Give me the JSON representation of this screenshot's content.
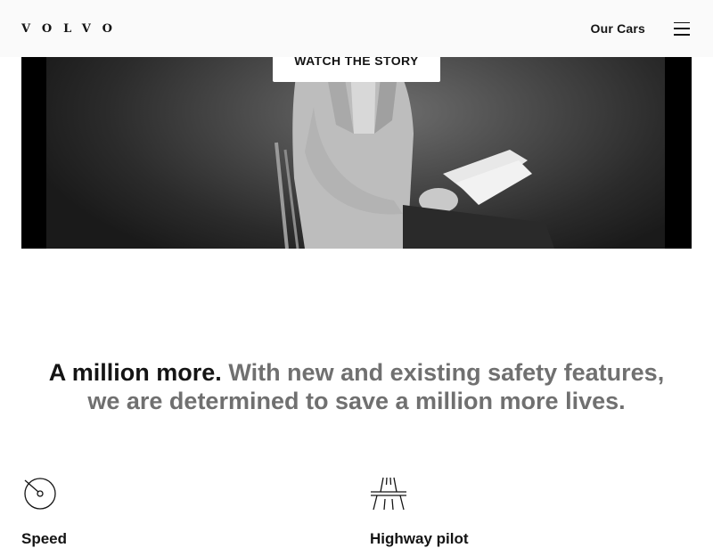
{
  "header": {
    "logo": "VOLVO",
    "nav_link": "Our Cars",
    "menu_icon": "hamburger-menu-icon"
  },
  "hero": {
    "button_label": "WATCH THE STORY"
  },
  "statement": {
    "lead": "A million more.",
    "body": "With new and existing safety features, we are determined to save a million more lives."
  },
  "features": [
    {
      "icon": "speedometer-icon",
      "title": "Speed"
    },
    {
      "icon": "highway-icon",
      "title": "Highway pilot"
    }
  ]
}
